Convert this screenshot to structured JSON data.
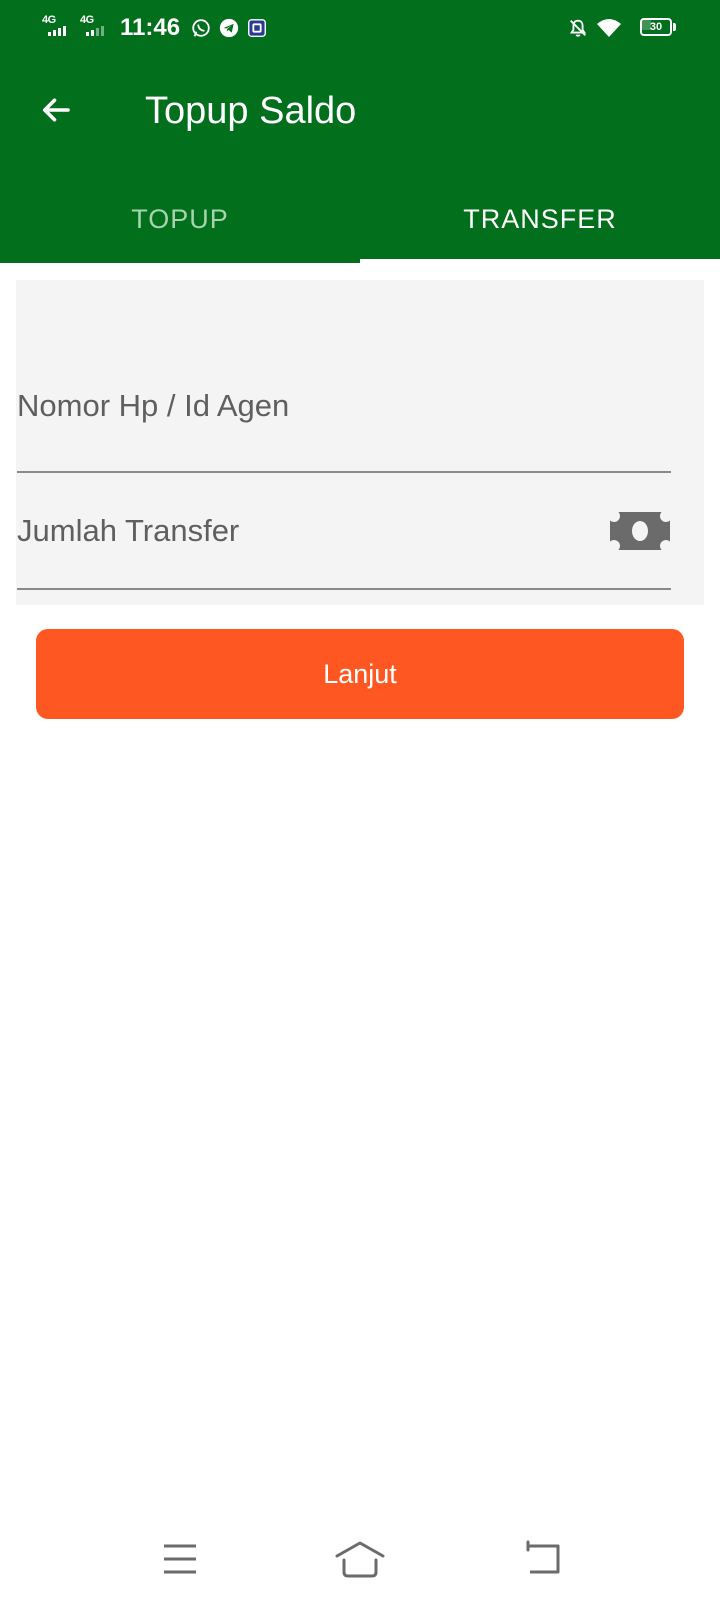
{
  "status_bar": {
    "time": "11:46",
    "network_1": "4G",
    "network_2": "4G",
    "battery_level": "30",
    "icons": [
      "whatsapp-icon",
      "telegram-icon",
      "app-notification-icon",
      "mute-notifications-icon",
      "wifi-icon",
      "battery-icon"
    ]
  },
  "app_bar": {
    "title": "Topup Saldo",
    "back_icon": "arrow-left-icon"
  },
  "tabs": [
    {
      "label": "TOPUP",
      "selected": false
    },
    {
      "label": "TRANSFER",
      "selected": true
    }
  ],
  "form": {
    "phone_placeholder": "Nomor Hp / Id Agen",
    "phone_value": "",
    "amount_placeholder": "Jumlah Transfer",
    "amount_value": "",
    "amount_icon": "money-icon"
  },
  "submit_label": "Lanjut",
  "nav_bar": {
    "icons": [
      "menu-icon",
      "home-icon",
      "back-icon"
    ]
  },
  "colors": {
    "primary": "#016f1b",
    "accent": "#ff5722",
    "tab_inactive": "#a7d3ad",
    "form_background": "#f4f4f4"
  }
}
